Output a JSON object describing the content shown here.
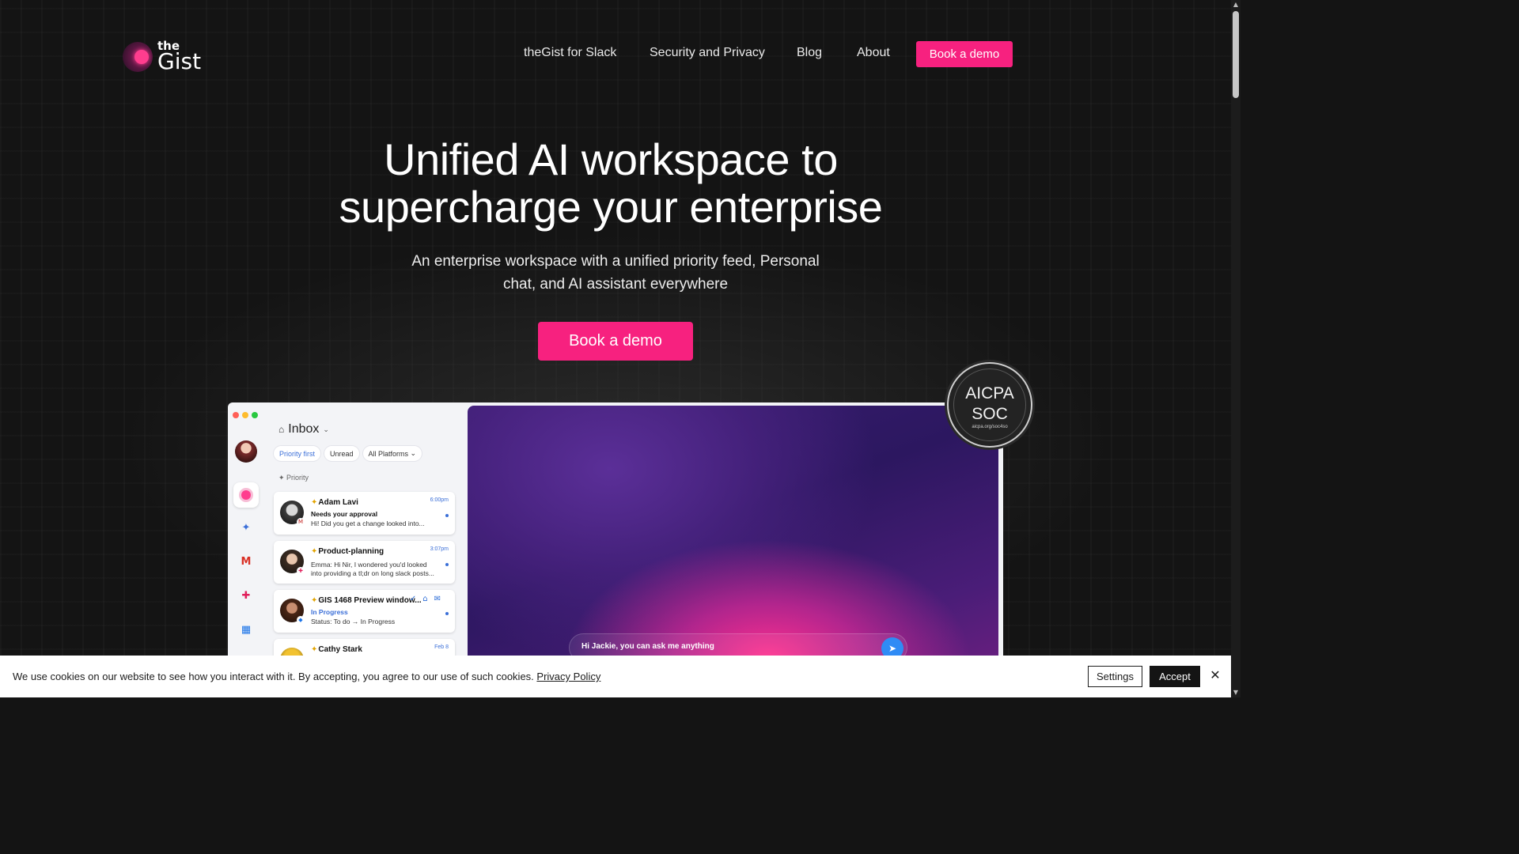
{
  "header": {
    "logo_top": "the",
    "logo_bottom": "Gist",
    "nav": [
      "theGist for Slack",
      "Security and Privacy",
      "Blog",
      "About"
    ],
    "cta": "Book a demo"
  },
  "hero": {
    "title_line1": "Unified AI workspace to",
    "title_line2": "supercharge your enterprise",
    "subtitle_line1": "An enterprise workspace with a unified priority feed, Personal",
    "subtitle_line2": "chat, and AI assistant everywhere",
    "cta": "Book a demo"
  },
  "badge": {
    "line1": "AICPA",
    "line2": "SOC",
    "line3": "aicpa.org/soc4so"
  },
  "mockup": {
    "inbox_title": "Inbox",
    "filters": [
      "Priority first",
      "Unread",
      "All Platforms"
    ],
    "section_label": "Priority",
    "cards": [
      {
        "name": "Adam Lavi",
        "time": "6:00pm",
        "line1": "Needs your approval",
        "line2": "Hi! Did you get a change looked into..."
      },
      {
        "name": "Product-planning",
        "time": "3:07pm",
        "line1": "Emma: Hi Nir, I wondered you'd looked",
        "line2": "into providing a tl;dr on long slack posts..."
      },
      {
        "name": "GIS 1468 Preview window...",
        "time": "",
        "line1": "In Progress",
        "line2": "Status: To do → In Progress"
      },
      {
        "name": "Cathy Stark",
        "time": "Feb 8",
        "line1": "",
        "line2": ""
      }
    ],
    "ask_placeholder": "Hi Jackie, you can ask me anything"
  },
  "cookie": {
    "message": "We use cookies on our website to see how you interact with it. By accepting, you agree to our use of such cookies.",
    "link": "Privacy Policy",
    "settings": "Settings",
    "accept": "Accept"
  },
  "colors": {
    "accent": "#f7217f",
    "background": "#141414",
    "link_blue": "#3b6fd8"
  }
}
